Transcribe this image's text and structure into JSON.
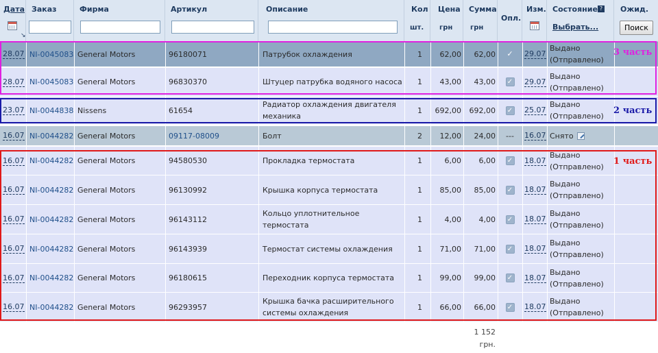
{
  "header": {
    "date": "Дата",
    "order": "Заказ",
    "firm": "Фирма",
    "article": "Артикул",
    "description": "Описание",
    "qty": "Кол",
    "qty_unit": "шт.",
    "price": "Цена",
    "price_unit": "грн",
    "sum": "Сумма",
    "sum_unit": "грн",
    "paid": "Опл.",
    "changed": "Изм.",
    "status": "Состояние",
    "status_select": "Выбрать...",
    "wait": "Ожид.",
    "search_button": "Поиск"
  },
  "filters": {
    "order": "",
    "firm": "",
    "article": "",
    "description": ""
  },
  "rows": [
    {
      "date": "28.07",
      "order": "NI-0045083",
      "firm": "General Motors",
      "article": "96180071",
      "description": "Патрубок охлаждения",
      "qty": "1",
      "price": "62,00",
      "sum": "62,00",
      "paid": "✓",
      "changed": "29.07",
      "status": "Выдано (Отправлено)"
    },
    {
      "date": "28.07",
      "order": "NI-0045083",
      "firm": "General Motors",
      "article": "96830370",
      "description": "Штуцер патрубка водяного насоса",
      "qty": "1",
      "price": "43,00",
      "sum": "43,00",
      "paid": "✓",
      "changed": "29.07",
      "status": "Выдано (Отправлено)"
    },
    {
      "date": "23.07",
      "order": "NI-0044838",
      "firm": "Nissens",
      "article": "61654",
      "description": "Радиатор охлаждения двигателя механика",
      "qty": "1",
      "price": "692,00",
      "sum": "692,00",
      "paid": "✓",
      "changed": "25.07",
      "status": "Выдано (Отправлено)"
    },
    {
      "date": "16.07",
      "order": "NI-0044282",
      "firm": "General Motors",
      "article": "09117-08009",
      "description": "Болт",
      "qty": "2",
      "price": "12,00",
      "sum": "24,00",
      "paid": "---",
      "changed": "16.07",
      "status": "Снято"
    },
    {
      "date": "16.07",
      "order": "NI-0044282",
      "firm": "General Motors",
      "article": "94580530",
      "description": "Прокладка термостата",
      "qty": "1",
      "price": "6,00",
      "sum": "6,00",
      "paid": "✓",
      "changed": "18.07",
      "status": "Выдано (Отправлено)"
    },
    {
      "date": "16.07",
      "order": "NI-0044282",
      "firm": "General Motors",
      "article": "96130992",
      "description": "Крышка корпуса термостата",
      "qty": "1",
      "price": "85,00",
      "sum": "85,00",
      "paid": "✓",
      "changed": "18.07",
      "status": "Выдано (Отправлено)"
    },
    {
      "date": "16.07",
      "order": "NI-0044282",
      "firm": "General Motors",
      "article": "96143112",
      "description": "Кольцо уплотнительное термостата",
      "qty": "1",
      "price": "4,00",
      "sum": "4,00",
      "paid": "✓",
      "changed": "18.07",
      "status": "Выдано (Отправлено)"
    },
    {
      "date": "16.07",
      "order": "NI-0044282",
      "firm": "General Motors",
      "article": "96143939",
      "description": "Термостат системы охлаждения",
      "qty": "1",
      "price": "71,00",
      "sum": "71,00",
      "paid": "✓",
      "changed": "18.07",
      "status": "Выдано (Отправлено)"
    },
    {
      "date": "16.07",
      "order": "NI-0044282",
      "firm": "General Motors",
      "article": "96180615",
      "description": "Переходник корпуса термостата",
      "qty": "1",
      "price": "99,00",
      "sum": "99,00",
      "paid": "✓",
      "changed": "18.07",
      "status": "Выдано (Отправлено)"
    },
    {
      "date": "16.07",
      "order": "NI-0044282",
      "firm": "General Motors",
      "article": "96293957",
      "description": "Крышка бачка расширительного системы охлаждения",
      "qty": "1",
      "price": "66,00",
      "sum": "66,00",
      "paid": "✓",
      "changed": "18.07",
      "status": "Выдано (Отправлено)"
    }
  ],
  "annotations": {
    "part3": "3 часть",
    "part2": "2 часть",
    "part1": "1 часть",
    "part3_color": "#e020e0",
    "part2_color": "#1a1aa8",
    "part1_color": "#e01818"
  },
  "total": {
    "value": "1 152",
    "unit": "грн."
  }
}
